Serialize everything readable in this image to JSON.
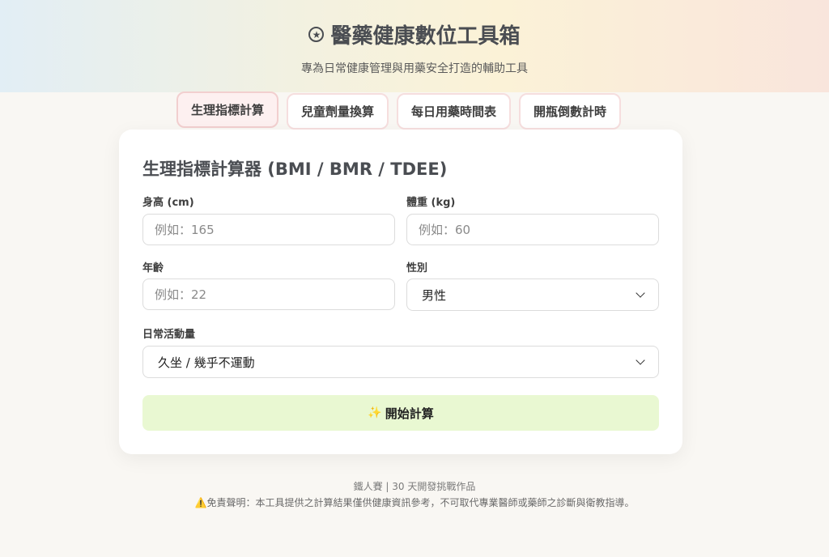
{
  "header": {
    "icon": "star-circle-icon",
    "title": "醫藥健康數位工具箱",
    "subtitle": "專為日常健康管理與用藥安全打造的輔助工具"
  },
  "tabs": [
    {
      "label": "生理指標計算",
      "active": true
    },
    {
      "label": "兒童劑量換算",
      "active": false
    },
    {
      "label": "每日用藥時間表",
      "active": false
    },
    {
      "label": "開瓶倒數計時",
      "active": false
    }
  ],
  "form": {
    "title": "生理指標計算器 (BMI / BMR / TDEE)",
    "height": {
      "label": "身高 (cm)",
      "placeholder": "例如：165",
      "value": ""
    },
    "weight": {
      "label": "體重 (kg)",
      "placeholder": "例如：60",
      "value": ""
    },
    "age": {
      "label": "年齡",
      "placeholder": "例如：22",
      "value": ""
    },
    "gender": {
      "label": "性別",
      "selected": "男性"
    },
    "activity": {
      "label": "日常活動量",
      "selected": "久坐 / 幾乎不運動"
    },
    "submit_label": "開始計算",
    "submit_icon": "sparkles-icon"
  },
  "footer": {
    "credit": "鐵人賽 | 30 天開發挑戰作品",
    "disclaimer": "免責聲明：本工具提供之計算結果僅供健康資訊參考，不可取代專業醫師或藥師之診斷與衛教指導。",
    "disclaimer_icon": "warning-icon"
  },
  "colors": {
    "accent_button": "#e9f8d2",
    "active_tab_bg": "#fdf0f0",
    "tab_border": "#f6dede"
  }
}
